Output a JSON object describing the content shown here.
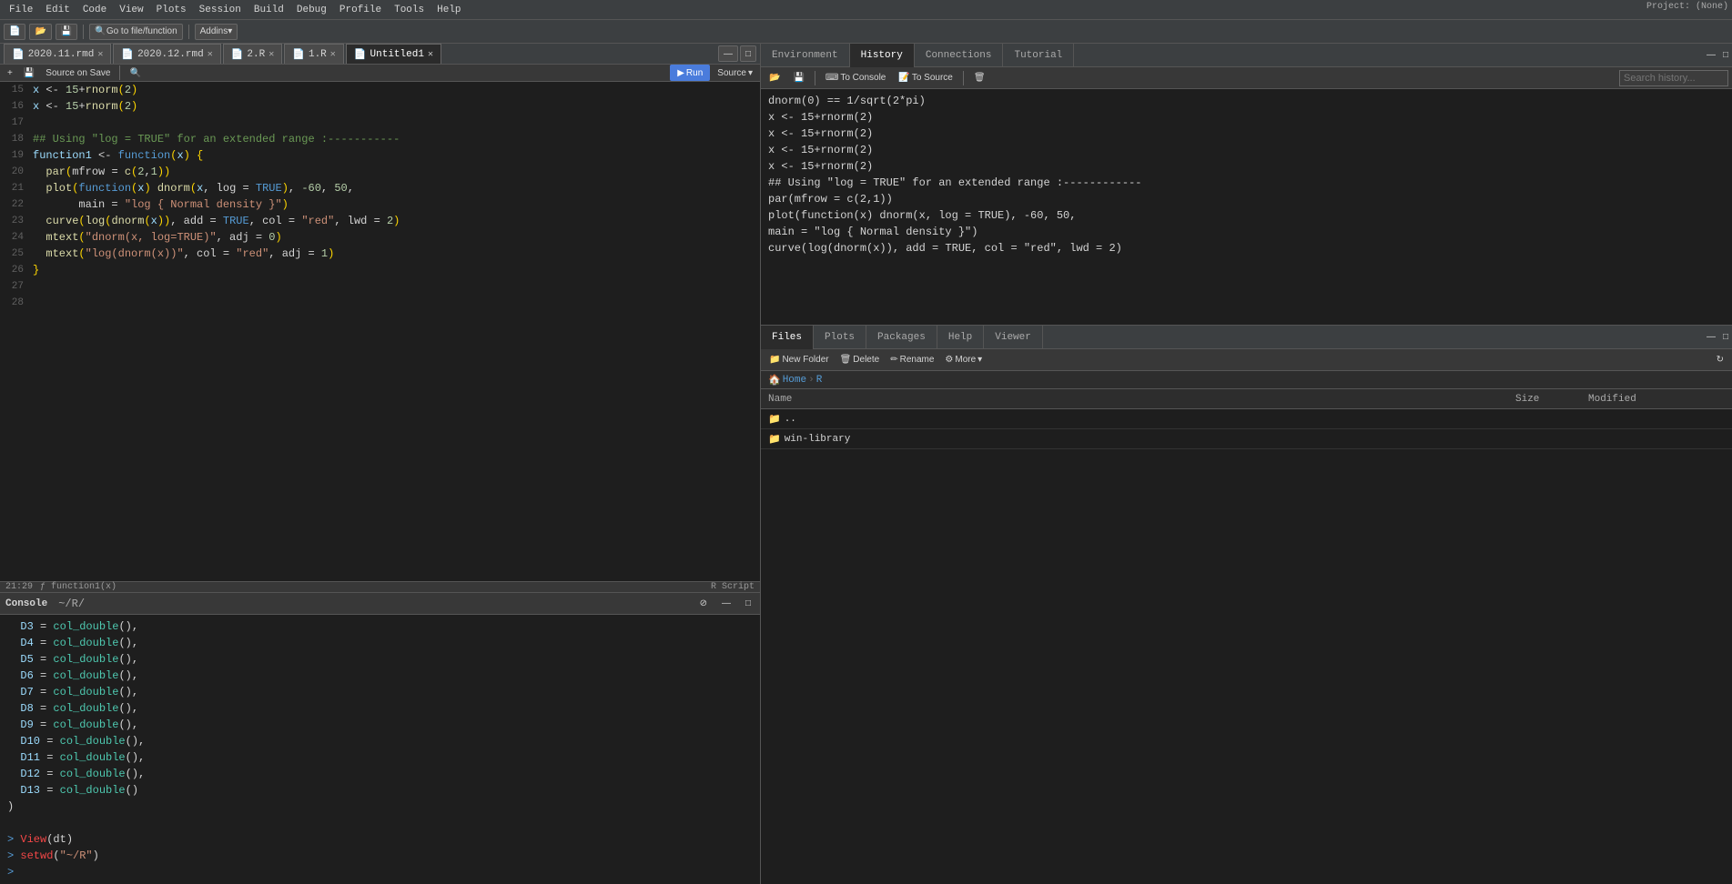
{
  "app": {
    "title": "RStudio",
    "project": "Project: (None)"
  },
  "menu": {
    "items": [
      "File",
      "Edit",
      "Code",
      "View",
      "Plots",
      "Session",
      "Build",
      "Debug",
      "Profile",
      "Tools",
      "Help"
    ]
  },
  "tabs": {
    "editor": [
      {
        "label": "2020.11.rmd",
        "active": false
      },
      {
        "label": "2020.12.rmd",
        "active": false
      },
      {
        "label": "2.R",
        "active": false
      },
      {
        "label": "1.R",
        "active": false
      },
      {
        "label": "Untitled1",
        "active": true
      }
    ]
  },
  "editor_toolbar": {
    "source_on_save": "Source on Save",
    "run": "Run",
    "source": "Source",
    "go_to_file": "Go to file/function",
    "addins": "Addins"
  },
  "editor": {
    "lines": [
      {
        "num": "15",
        "content": "x <- 15+rnorm(2)"
      },
      {
        "num": "16",
        "content": "x <- 15+rnorm(2)"
      },
      {
        "num": "17",
        "content": ""
      },
      {
        "num": "18",
        "content": "## Using \"log = TRUE\" for an extended range :-----------"
      },
      {
        "num": "19",
        "content": "function1 <- function(x) {"
      },
      {
        "num": "20",
        "content": "  par(mfrow = c(2,1))"
      },
      {
        "num": "21",
        "content": "  plot(function(x) dnorm(x, log = TRUE), -60, 50,"
      },
      {
        "num": "22",
        "content": "       main = \"log { Normal density }\")"
      },
      {
        "num": "23",
        "content": "  curve(log(dnorm(x)), add = TRUE, col = \"red\", lwd = 2)"
      },
      {
        "num": "24",
        "content": "  mtext(\"dnorm(x, log=TRUE)\", adj = 0)"
      },
      {
        "num": "25",
        "content": "  mtext(\"log(dnorm(x))\", col = \"red\", adj = 1)"
      },
      {
        "num": "26",
        "content": "}"
      },
      {
        "num": "27",
        "content": ""
      },
      {
        "num": "28",
        "content": ""
      }
    ],
    "status": {
      "position": "21:29",
      "function": "function1(x)",
      "script_type": "R Script"
    }
  },
  "console": {
    "title": "Console",
    "path": "~/R/",
    "lines": [
      "  D3 = col_double(),",
      "  D4 = col_double(),",
      "  D5 = col_double(),",
      "  D6 = col_double(),",
      "  D7 = col_double(),",
      "  D8 = col_double(),",
      "  D9 = col_double(),",
      "  D10 = col_double(),",
      "  D11 = col_double(),",
      "  D12 = col_double(),",
      "  D13 = col_double()",
      ")",
      "",
      "> View(dt)",
      "> setwd(\"~/R\")",
      ">"
    ]
  },
  "right_panel": {
    "top_tabs": [
      "Environment",
      "History",
      "Connections",
      "Tutorial"
    ],
    "active_top_tab": "History",
    "history_toolbar": {
      "to_console": "To Console",
      "to_source": "To Source"
    },
    "history_lines": [
      "dnorm(0) == 1/sqrt(2*pi)",
      "x <- 15+rnorm(2)",
      "x <- 15+rnorm(2)",
      "x <- 15+rnorm(2)",
      "x <- 15+rnorm(2)",
      "## Using \"log = TRUE\" for an extended range :------------",
      "par(mfrow = c(2,1))",
      "plot(function(x) dnorm(x, log = TRUE), -60, 50,",
      "main = \"log { Normal density }\")",
      "curve(log(dnorm(x)), add = TRUE, col = \"red\", lwd = 2)"
    ],
    "search_placeholder": "Search history...",
    "bottom_tabs": [
      "Files",
      "Plots",
      "Packages",
      "Help",
      "Viewer"
    ],
    "active_bottom_tab": "Files",
    "files_toolbar": {
      "new_folder": "New Folder",
      "delete": "Delete",
      "rename": "Rename",
      "more": "More"
    },
    "breadcrumb": [
      "Home",
      "R"
    ],
    "files_columns": {
      "name": "Name",
      "size": "Size",
      "modified": "Modified"
    },
    "files": [
      {
        "name": "..",
        "type": "parent",
        "size": "",
        "modified": ""
      },
      {
        "name": "win-library",
        "type": "folder",
        "size": "",
        "modified": ""
      }
    ]
  }
}
